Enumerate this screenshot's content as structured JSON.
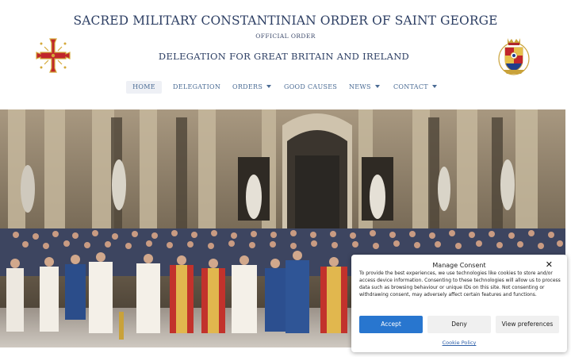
{
  "header": {
    "title": "SACRED MILITARY CONSTANTINIAN ORDER OF SAINT GEORGE",
    "tagline": "OFFICIAL ORDER",
    "subtitle": "DELEGATION FOR GREAT BRITAIN AND IRELAND"
  },
  "nav": {
    "items": [
      {
        "label": "HOME",
        "active": true
      },
      {
        "label": "DELEGATION"
      },
      {
        "label": "ORDERS",
        "dropdown": true
      },
      {
        "label": "GOOD CAUSES"
      },
      {
        "label": "NEWS",
        "dropdown": true
      },
      {
        "label": "CONTACT",
        "dropdown": true
      }
    ]
  },
  "logos": {
    "left_icon": "constantinian-cross-icon",
    "right_icon": "royal-coat-of-arms-icon"
  },
  "hero": {
    "image": "group-photo-in-basilica"
  },
  "consent": {
    "title": "Manage Consent",
    "text": "To provide the best experiences, we use technologies like cookies to store and/or access device information. Consenting to these technologies will allow us to process data such as browsing behaviour or unique IDs on this site. Not consenting or withdrawing consent, may adversely affect certain features and functions.",
    "accept_label": "Accept",
    "deny_label": "Deny",
    "preferences_label": "View preferences",
    "policy_link": "Cookie Policy",
    "close_icon": "close-icon"
  },
  "colors": {
    "title": "#2c3e63",
    "nav_text": "#4a6b94",
    "accept": "#2876cf",
    "cross_red": "#c0262c",
    "cross_gold": "#d4a93a"
  }
}
